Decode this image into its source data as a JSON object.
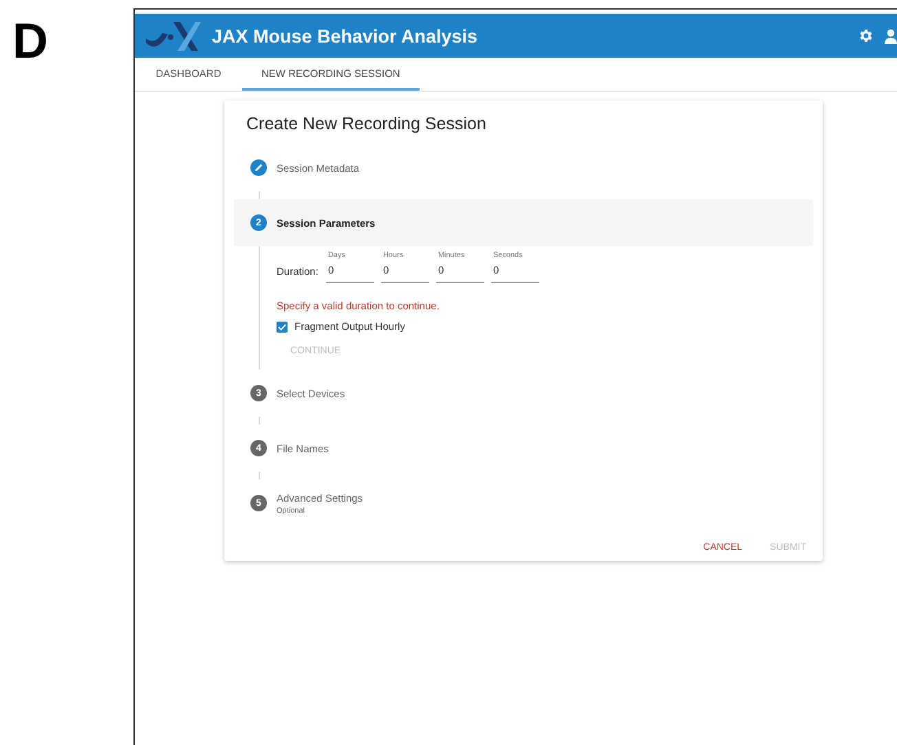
{
  "panel_label": "D",
  "app": {
    "title": "JAX Mouse Behavior Analysis"
  },
  "tabs": [
    {
      "label": "DASHBOARD",
      "selected": false
    },
    {
      "label": "NEW RECORDING SESSION",
      "selected": true
    }
  ],
  "card": {
    "title": "Create New Recording Session",
    "steps": [
      {
        "kind": "edit",
        "label": "Session Metadata",
        "active": false
      },
      {
        "kind": "number",
        "number": "2",
        "label": "Session Parameters",
        "active": true
      },
      {
        "kind": "number",
        "number": "3",
        "label": "Select Devices",
        "active": false
      },
      {
        "kind": "number",
        "number": "4",
        "label": "File Names",
        "active": false
      },
      {
        "kind": "number",
        "number": "5",
        "label": "Advanced Settings",
        "sublabel": "Optional",
        "active": false
      }
    ],
    "duration": {
      "label": "Duration:",
      "fields": [
        {
          "label": "Days",
          "value": "0"
        },
        {
          "label": "Hours",
          "value": "0"
        },
        {
          "label": "Minutes",
          "value": "0"
        },
        {
          "label": "Seconds",
          "value": "0"
        }
      ]
    },
    "error": "Specify a valid duration to continue.",
    "checkbox": {
      "label": "Fragment Output Hourly",
      "checked": true
    },
    "continue_button": {
      "label": "CONTINUE",
      "disabled": true
    },
    "actions": [
      {
        "label": "CANCEL",
        "disabled": false
      },
      {
        "label": "SUBMIT",
        "disabled": true
      }
    ]
  }
}
